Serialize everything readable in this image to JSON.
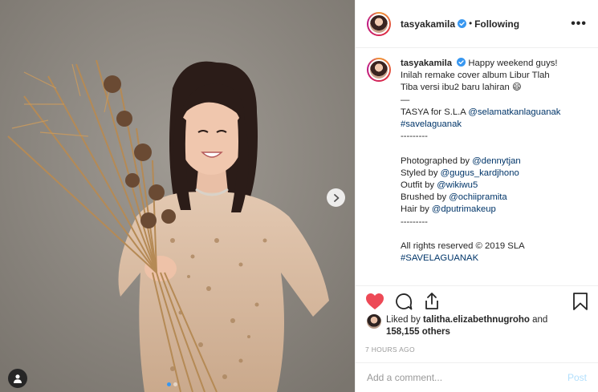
{
  "colors": {
    "accent": "#3897f0",
    "like": "#ed4956",
    "link": "#003569",
    "muted": "#999999",
    "post_disabled": "#b2dffc"
  },
  "header": {
    "username": "tasyakamila",
    "separator": "•",
    "follow_status": "Following",
    "more_label": "•••"
  },
  "caption": {
    "username": "tasyakamila",
    "first_line": "Happy weekend guys!",
    "lines": [
      "Inilah remake cover album Libur Tlah",
      "Tiba versi ibu2 baru lahiran 😄"
    ],
    "dash": "—",
    "credit_prefix": "TASYA for S.L.A ",
    "credit_mention": "@selamatkanlaguanak",
    "credit_hashtag": "#savelaguanak",
    "divider1": "---------",
    "photographed_label": "Photographed by ",
    "photographed_mention": "@dennytjan",
    "styled_label": "Styled by ",
    "styled_mention": "@gugus_kardjhono",
    "outfit_label": "Outfit by ",
    "outfit_mention": "@wikiwu5",
    "brushed_label": "Brushed by ",
    "brushed_mention": "@ochiipramita",
    "hair_label": "Hair by ",
    "hair_mention": "@dputrimakeup",
    "divider2": "---------",
    "rights": "All rights reserved © 2019 SLA",
    "rights_hashtag": "#SAVELAGUANAK"
  },
  "icons": {
    "like": "heart-icon",
    "comment": "comment-icon",
    "share": "share-icon",
    "save": "bookmark-icon",
    "next": "chevron-right-icon",
    "tag": "user-tag-icon"
  },
  "likes": {
    "prefix": "Liked by ",
    "user": "talitha.elizabethnugroho",
    "middle": " and",
    "count": "158,155 others"
  },
  "timestamp": "7 HOURS AGO",
  "comment_box": {
    "placeholder": "Add a comment...",
    "post_label": "Post"
  },
  "carousel": {
    "current": 1,
    "total": 2
  }
}
